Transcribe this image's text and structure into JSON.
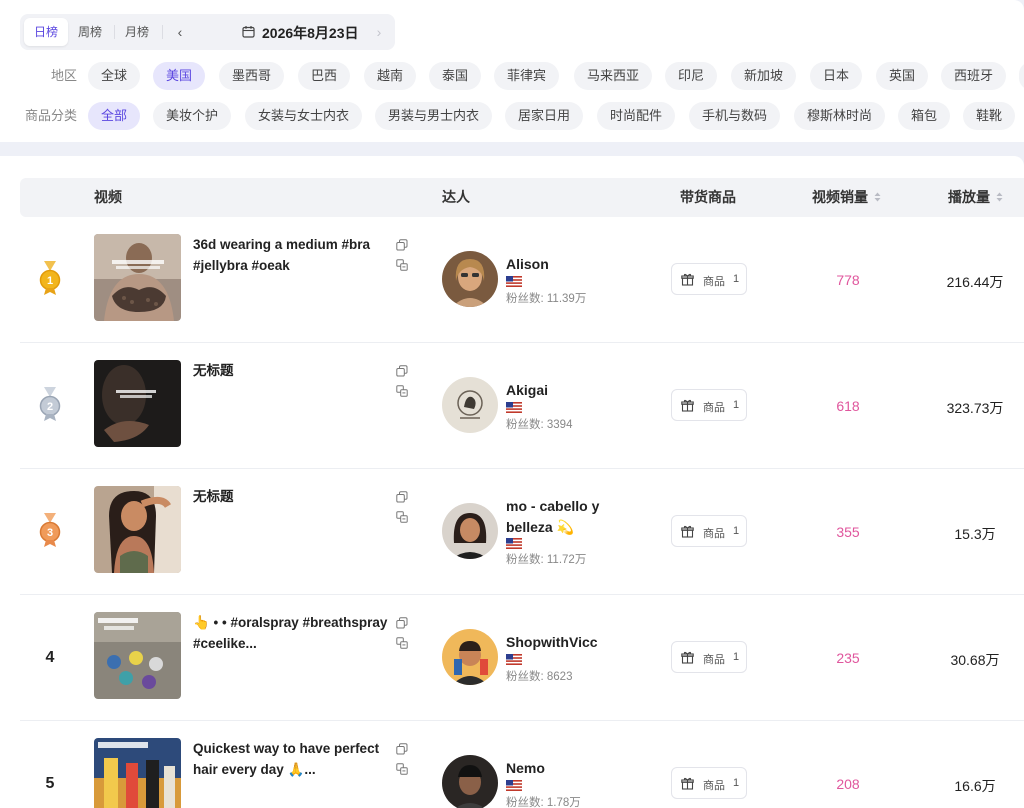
{
  "period": {
    "tabs": [
      "日榜",
      "周榜",
      "月榜"
    ],
    "active_tab": "日榜",
    "date": "2026年8月23日",
    "prev_icon": "chevron-left-icon",
    "next_icon": "chevron-right-icon",
    "calendar_icon": "calendar-icon"
  },
  "region": {
    "label": "地区",
    "chips": [
      "全球",
      "美国",
      "墨西哥",
      "巴西",
      "越南",
      "泰国",
      "菲律宾",
      "马来西亚",
      "印尼",
      "新加坡",
      "日本",
      "英国",
      "西班牙"
    ],
    "active": "美国"
  },
  "category": {
    "label": "商品分类",
    "chips": [
      "全部",
      "美妆个护",
      "女装与女士内衣",
      "男装与男士内衣",
      "居家日用",
      "时尚配件",
      "手机与数码",
      "穆斯林时尚",
      "箱包",
      "鞋靴"
    ],
    "active": "全部"
  },
  "table": {
    "headers": {
      "video": "视频",
      "creator": "达人",
      "goods": "带货商品",
      "sales": "视频销量",
      "plays": "播放量"
    },
    "rows": [
      {
        "rank": "1",
        "medal": "gold-medal-icon",
        "title": "36d wearing a medium #bra #jellybra #oeak",
        "creator": "Alison",
        "fans": "粉丝数: 11.39万",
        "goods_label": "商品",
        "goods_count": "1",
        "sales": "778",
        "plays": "216.44万"
      },
      {
        "rank": "2",
        "medal": "silver-medal-icon",
        "title": "无标题",
        "creator": "Akigai",
        "fans": "粉丝数: 3394",
        "goods_label": "商品",
        "goods_count": "1",
        "sales": "618",
        "plays": "323.73万"
      },
      {
        "rank": "3",
        "medal": "bronze-medal-icon",
        "title": "无标题",
        "creator": "mo - cabello y belleza 💫",
        "fans": "粉丝数: 11.72万",
        "goods_label": "商品",
        "goods_count": "1",
        "sales": "355",
        "plays": "15.3万"
      },
      {
        "rank": "4",
        "medal": "",
        "title": "👆 • • #oralspray #breathspray #ceelike...",
        "creator": "ShopwithVicc",
        "fans": "粉丝数: 8623",
        "goods_label": "商品",
        "goods_count": "1",
        "sales": "235",
        "plays": "30.68万"
      },
      {
        "rank": "5",
        "medal": "",
        "title": "Quickest way to have perfect hair every day 🙏...",
        "creator": "Nemo",
        "fans": "粉丝数: 1.78万",
        "goods_label": "商品",
        "goods_count": "1",
        "sales": "208",
        "plays": "16.6万"
      }
    ]
  },
  "colors": {
    "accent": "#5b47e0",
    "sales": "#e0569d",
    "gold": "#e8a317",
    "silver": "#a9b3c1",
    "bronze": "#e8894a"
  }
}
